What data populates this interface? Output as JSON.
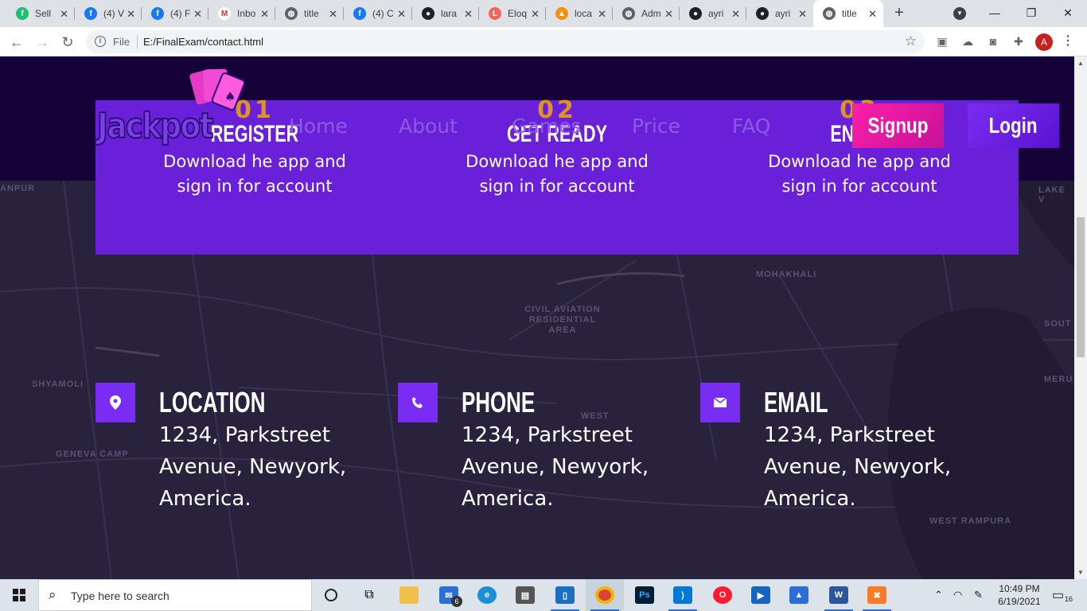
{
  "browser": {
    "tabs": [
      {
        "label": "Sell",
        "icon": "fiverr-icon",
        "color": "#1dbf73",
        "glyph": "f"
      },
      {
        "label": "(4) V",
        "icon": "facebook-icon",
        "color": "#1877f2",
        "glyph": "f"
      },
      {
        "label": "(4) F",
        "icon": "facebook-icon",
        "color": "#1877f2",
        "glyph": "f"
      },
      {
        "label": "Inbo",
        "icon": "gmail-icon",
        "color": "#ffffff",
        "glyph": "M"
      },
      {
        "label": "title",
        "icon": "globe-icon",
        "color": "#5f6368",
        "glyph": "◍"
      },
      {
        "label": "(4) C",
        "icon": "facebook-icon",
        "color": "#1877f2",
        "glyph": "f"
      },
      {
        "label": "lara",
        "icon": "github-icon",
        "color": "#202124",
        "glyph": "●"
      },
      {
        "label": "Eloq",
        "icon": "laravel-icon",
        "color": "#f4645f",
        "glyph": "L"
      },
      {
        "label": "loca",
        "icon": "phpmyadmin-icon",
        "color": "#f29111",
        "glyph": "▲"
      },
      {
        "label": "Adm",
        "icon": "globe-icon",
        "color": "#5f6368",
        "glyph": "◍"
      },
      {
        "label": "ayri",
        "icon": "github-icon",
        "color": "#202124",
        "glyph": "●"
      },
      {
        "label": "ayri",
        "icon": "github-icon",
        "color": "#202124",
        "glyph": "●"
      },
      {
        "label": "title",
        "icon": "globe-icon",
        "color": "#5f6368",
        "glyph": "◍"
      }
    ],
    "active_tab": 12,
    "omnibox": {
      "scheme_label": "File",
      "url": "E:/FinalExam/contact.html"
    },
    "profile_initial": "A"
  },
  "site": {
    "logo_text": "Jackpot",
    "nav": [
      "Home",
      "About",
      "Games",
      "Price",
      "FAQ"
    ],
    "signup_label": "Signup",
    "login_label": "Login",
    "steps": [
      {
        "num": "01",
        "title": "REGISTER",
        "desc": "Download he app and sign in for account"
      },
      {
        "num": "02",
        "title": "GET READY",
        "desc": "Download he app and sign in for account"
      },
      {
        "num": "03",
        "title": "ENJOY",
        "desc": "Download he app and sign in for account"
      }
    ],
    "contacts": [
      {
        "title": "LOCATION",
        "text": "1234, Parkstreet Avenue, Newyork, America.",
        "icon": "map-pin-icon"
      },
      {
        "title": "PHONE",
        "text": "1234, Parkstreet Avenue, Newyork, America.",
        "icon": "phone-icon"
      },
      {
        "title": "EMAIL",
        "text": "1234, Parkstreet Avenue, Newyork, America.",
        "icon": "envelope-icon"
      }
    ],
    "map_labels": [
      "ANPUR",
      "LAKE V",
      "MOHAKHALI",
      "CIVIL AVIATION RESIDENTIAL AREA",
      "SOUT",
      "SHYAMOLI",
      "MERU",
      "GENEVA CAMP",
      "WEST",
      "WEST RAMPURA"
    ],
    "colors": {
      "accent": "#6a1fd9",
      "signup": "#ff1fa8",
      "header": "#140238"
    }
  },
  "taskbar": {
    "search_placeholder": "Type here to search",
    "mail_badge": "6",
    "time": "10:49 PM",
    "date": "6/19/2021",
    "notifications": "16"
  }
}
